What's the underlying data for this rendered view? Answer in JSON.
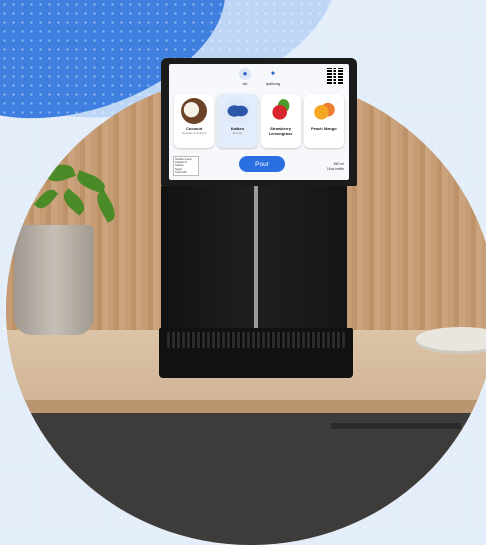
{
  "screen": {
    "nav": [
      {
        "label": "ski",
        "icon": "drop-icon"
      },
      {
        "label": "Ipattung",
        "icon": "sparkle-icon"
      }
    ],
    "qr": "qr-code",
    "cards": [
      {
        "title": "Coconut",
        "subtitle": "Hydrate & Refresh",
        "icon": "coconut-icon",
        "selected": false
      },
      {
        "title": "Kalbeo",
        "subtitle": "Energy",
        "icon": "seeds-icon",
        "selected": true
      },
      {
        "title": "Strawberry Lemongrass",
        "subtitle": "",
        "icon": "strawberry-icon",
        "selected": false
      },
      {
        "title": "Peach Mango",
        "subtitle": "",
        "icon": "peach-icon",
        "selected": false
      }
    ],
    "pour_label": "Pour",
    "nutrition_lines": [
      "Nutrition Facts",
      "Calories 0",
      "Sodium",
      "Sugar",
      "Total Carb"
    ],
    "info_lines": [
      "450 ml",
      "16oz bottle"
    ],
    "accent": "#2a6fe0"
  }
}
